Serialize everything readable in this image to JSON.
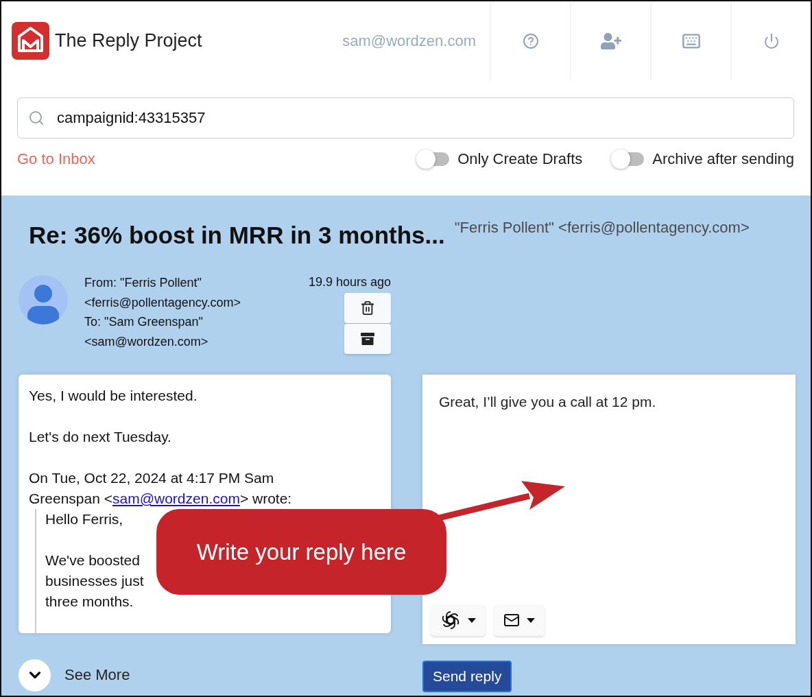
{
  "header": {
    "app_name": "The Reply Project",
    "user_email": "sam@wordzen.com",
    "actions": [
      {
        "kind": "help"
      },
      {
        "kind": "add-user"
      },
      {
        "kind": "keyboard"
      },
      {
        "kind": "power"
      }
    ]
  },
  "search": {
    "value": "campaignid:43315357"
  },
  "inbox_link": "Go to Inbox",
  "toggles": [
    {
      "label": "Only Create Drafts",
      "on": false
    },
    {
      "label": "Archive after sending",
      "on": false
    }
  ],
  "thread": {
    "subject": "Re: 36% boost in MRR in 3 months...",
    "participant": "\"Ferris Pollent\" <ferris@pollentagency.com>"
  },
  "message": {
    "sender_lines": [
      "From: \"Ferris Pollent\"",
      "<ferris@pollentagency.com>",
      "To: \"Sam Greenspan\"",
      "<sam@wordzen.com>"
    ],
    "time": "19.9 hours ago",
    "actions": [
      {
        "kind": "delete"
      },
      {
        "kind": "archive"
      }
    ],
    "body": [
      "Yes, I would be interested.",
      "Let's do next Tuesday."
    ],
    "quote_intro": {
      "before": "On Tue, Oct 22, 2024 at 4:17 PM Sam Greenspan <",
      "link": "sam@wordzen.com",
      "after": "> wrote:"
    },
    "quoted_paragraphs": [
      [
        "Hello Ferris,"
      ],
      [
        "We've boosted",
        "businesses just",
        "three months."
      ]
    ]
  },
  "reply": {
    "value": "Great, I’ll give you a call at 12 pm.",
    "tools": [
      {
        "kind": "ai"
      },
      {
        "kind": "template"
      }
    ],
    "send_label": "Send reply"
  },
  "see_more": "See More",
  "callout": "Write your reply here"
}
